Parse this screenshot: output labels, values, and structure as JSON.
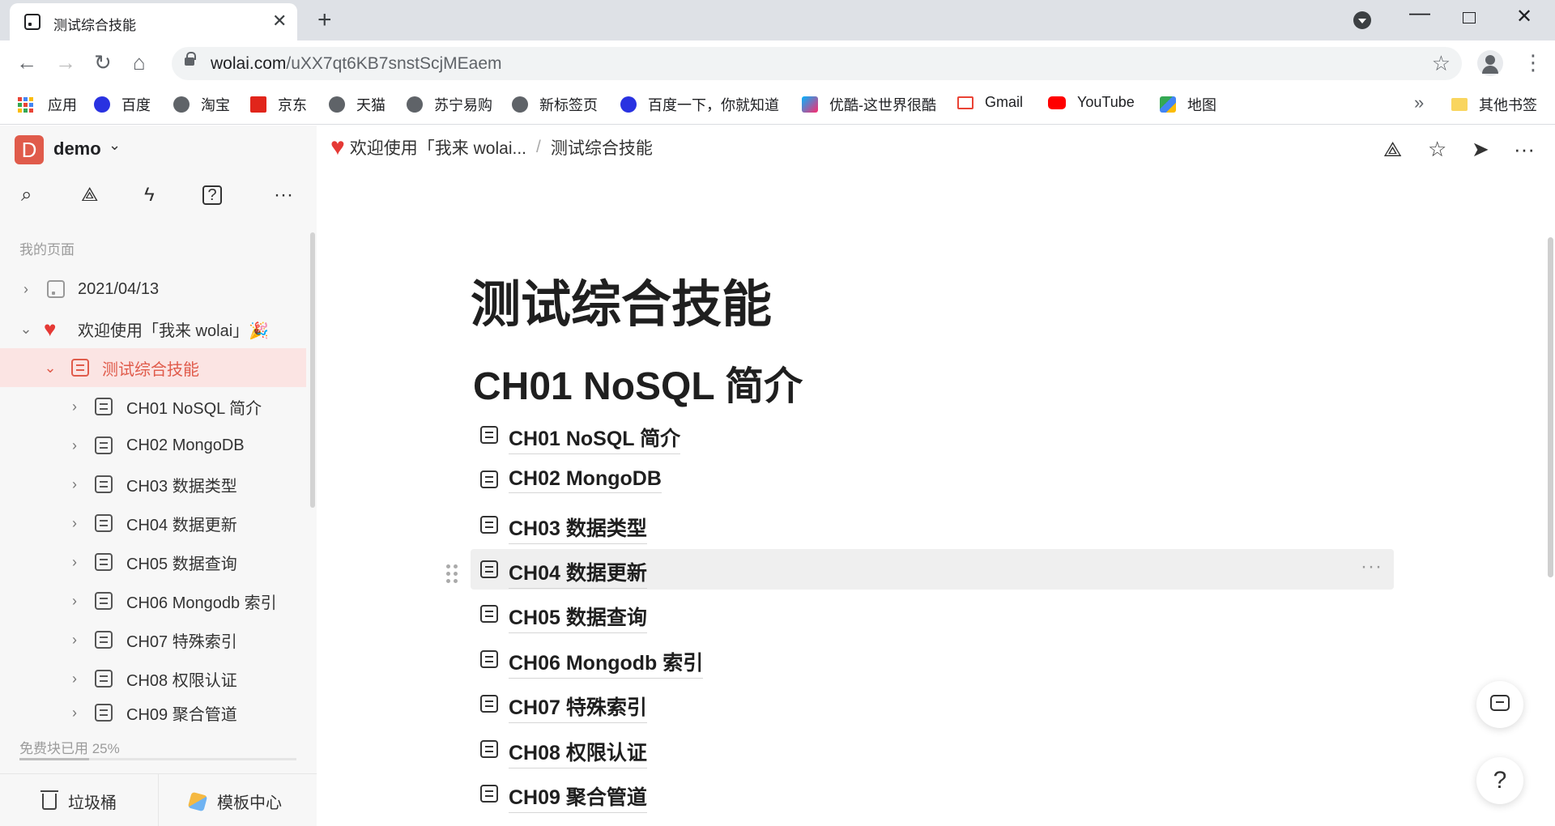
{
  "browser": {
    "tab_title": "测试综合技能",
    "url_host": "wolai.com",
    "url_path": "/uXX7qt6KB7snstScjMEaem"
  },
  "bookmarks": [
    {
      "label": "应用",
      "icon": "apps-grid-icon"
    },
    {
      "label": "百度",
      "icon": "baidu-icon"
    },
    {
      "label": "淘宝",
      "icon": "globe-icon"
    },
    {
      "label": "京东",
      "icon": "jd-icon"
    },
    {
      "label": "天猫",
      "icon": "globe-icon"
    },
    {
      "label": "苏宁易购",
      "icon": "globe-icon"
    },
    {
      "label": "新标签页",
      "icon": "globe-icon"
    },
    {
      "label": "百度一下，你就知道",
      "icon": "baidu-icon"
    },
    {
      "label": "优酷-这世界很酷",
      "icon": "youku-icon"
    },
    {
      "label": "Gmail",
      "icon": "gmail-icon"
    },
    {
      "label": "YouTube",
      "icon": "youtube-icon"
    },
    {
      "label": "地图",
      "icon": "maps-icon"
    }
  ],
  "bookmarks_more": "»",
  "other_bookmarks": "其他书签",
  "sidebar": {
    "workspace_initial": "D",
    "workspace_name": "demo",
    "section_label": "我的页面",
    "tree": [
      {
        "label": "2021/04/13",
        "level": 0,
        "expanded": false
      },
      {
        "label": "欢迎使用「我来 wolai」🎉",
        "level": 0,
        "expanded": true
      },
      {
        "label": "测试综合技能",
        "level": 1,
        "expanded": true,
        "active": true
      },
      {
        "label": "CH01 NoSQL 简介",
        "level": 2
      },
      {
        "label": "CH02 MongoDB",
        "level": 2
      },
      {
        "label": "CH03 数据类型",
        "level": 2
      },
      {
        "label": "CH04 数据更新",
        "level": 2
      },
      {
        "label": "CH05 数据查询",
        "level": 2
      },
      {
        "label": "CH06 Mongodb 索引",
        "level": 2
      },
      {
        "label": "CH07 特殊索引",
        "level": 2
      },
      {
        "label": "CH08 权限认证",
        "level": 2
      },
      {
        "label": "CH09 聚合管道",
        "level": 2
      }
    ],
    "quota_text": "免费块已用 25%",
    "quota_percent": 25,
    "trash_label": "垃圾桶",
    "templates_label": "模板中心"
  },
  "breadcrumb": {
    "parent": "欢迎使用「我来 wolai...",
    "separator": "/",
    "current": "测试综合技能"
  },
  "page": {
    "title": "测试综合技能",
    "heading": "CH01 NoSQL 简介",
    "subpages": [
      "CH01 NoSQL 简介",
      "CH02 MongoDB",
      "CH03 数据类型",
      "CH04 数据更新",
      "CH05 数据查询",
      "CH06 Mongodb 索引",
      "CH07 特殊索引",
      "CH08 权限认证",
      "CH09 聚合管道"
    ],
    "hovered_index": 3,
    "row_more": "···",
    "help_label": "?"
  },
  "colors": {
    "brand": "#e05b4b",
    "active_bg": "#fbe4e3",
    "sidebar_bg": "#f7f7f7"
  }
}
